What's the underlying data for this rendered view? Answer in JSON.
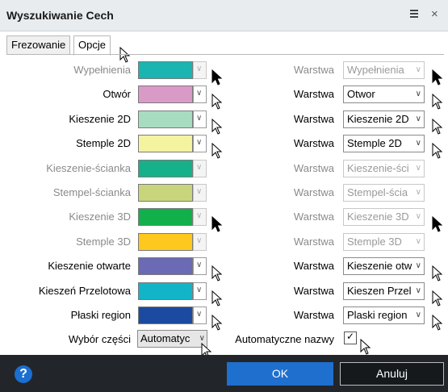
{
  "window": {
    "title": "Wyszukiwanie Cech"
  },
  "tabs": [
    {
      "label": "Frezowanie",
      "active": false
    },
    {
      "label": "Opcje",
      "active": true
    }
  ],
  "rows": [
    {
      "label": "Wypełnienia",
      "enabled": false,
      "color": "#1ab5b0",
      "layer_label": "Warstwa",
      "layer_value": "Wypełnienia",
      "layer_enabled": false
    },
    {
      "label": "Otwór",
      "enabled": true,
      "color": "#d99ac8",
      "layer_label": "Warstwa",
      "layer_value": "Otwor",
      "layer_enabled": true
    },
    {
      "label": "Kieszenie 2D",
      "enabled": true,
      "color": "#a8dcc0",
      "layer_label": "Warstwa",
      "layer_value": "Kieszenie 2D",
      "layer_enabled": true
    },
    {
      "label": "Stemple 2D",
      "enabled": true,
      "color": "#f3f3a0",
      "layer_label": "Warstwa",
      "layer_value": "Stemple 2D",
      "layer_enabled": true
    },
    {
      "label": "Kieszenie-ścianka",
      "enabled": false,
      "color": "#16b08a",
      "layer_label": "Warstwa",
      "layer_value": "Kieszenie-ści",
      "layer_enabled": false
    },
    {
      "label": "Stempel-ścianka",
      "enabled": false,
      "color": "#c9d57a",
      "layer_label": "Warstwa",
      "layer_value": "Stempel-ścia",
      "layer_enabled": false
    },
    {
      "label": "Kieszenie 3D",
      "enabled": false,
      "color": "#12b04a",
      "layer_label": "Warstwa",
      "layer_value": "Kieszenie 3D",
      "layer_enabled": false
    },
    {
      "label": "Stemple 3D",
      "enabled": false,
      "color": "#ffc81e",
      "layer_label": "Warstwa",
      "layer_value": "Stemple 3D",
      "layer_enabled": false
    },
    {
      "label": "Kieszenie otwarte",
      "enabled": true,
      "color": "#6a6ab5",
      "layer_label": "Warstwa",
      "layer_value": "Kieszenie otw",
      "layer_enabled": true
    },
    {
      "label": "Kieszeń Przelotowa",
      "enabled": true,
      "color": "#12b5c8",
      "layer_label": "Warstwa",
      "layer_value": "Kieszen Przel",
      "layer_enabled": true
    },
    {
      "label": "Płaski region",
      "enabled": true,
      "color": "#1c4aa0",
      "layer_label": "Warstwa",
      "layer_value": "Plaski region",
      "layer_enabled": true
    }
  ],
  "part_selection": {
    "label": "Wybór części",
    "value": "Automatyc"
  },
  "auto_names": {
    "label": "Automatyczne nazwy",
    "checked": true
  },
  "footer": {
    "help": "?",
    "ok": "OK",
    "cancel": "Anuluj"
  },
  "glyphs": {
    "chevron": "∨",
    "check": "✓",
    "close": "×"
  }
}
